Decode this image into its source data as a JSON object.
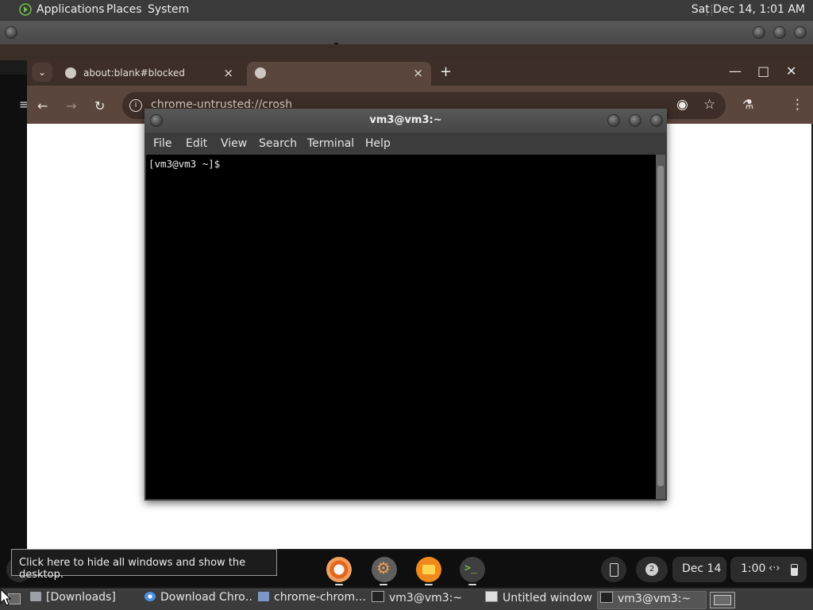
{
  "top_panel": {
    "menus": [
      "Applications",
      "Places",
      "System"
    ],
    "clock": "Sat Dec 14,  1:01 AM"
  },
  "chrome": {
    "tabs": [
      {
        "title": "about:blank#blocked",
        "close": "×"
      },
      {
        "title": "",
        "close": "×"
      }
    ],
    "tab_search": "⌄",
    "new_tab": "+",
    "window_controls": {
      "minimize": "—",
      "maximize": "□",
      "close": "✕"
    },
    "address": "chrome-untrusted://crosh",
    "nav": {
      "back": "←",
      "forward": "→",
      "reload": "↻"
    },
    "toolbar_icons": {
      "eye": "◉",
      "star": "☆",
      "labs": "⚗",
      "menu": "⋮"
    }
  },
  "terminal": {
    "title": "vm3@vm3:~",
    "menus": [
      "File",
      "Edit",
      "View",
      "Search",
      "Terminal",
      "Help"
    ],
    "prompt": "[vm3@vm3 ~]$"
  },
  "shelf": {
    "tooltip": "Click here to hide all windows and show the desktop.",
    "notification_count": "2",
    "date": "Dec 14",
    "time": "1:00",
    "apps": [
      "chrome",
      "settings",
      "files",
      "terminal"
    ]
  },
  "taskbar": {
    "items": [
      {
        "label": "[Downloads]",
        "icon": "folder-icon"
      },
      {
        "label": "Download Chro…",
        "icon": "chrome-icon"
      },
      {
        "label": "chrome-chrom…",
        "icon": "app-icon"
      },
      {
        "label": "vm3@vm3:~",
        "icon": "terminal-icon"
      },
      {
        "label": "Untitled window",
        "icon": "window-icon"
      },
      {
        "label": "vm3@vm3:~",
        "icon": "terminal-icon"
      }
    ]
  }
}
